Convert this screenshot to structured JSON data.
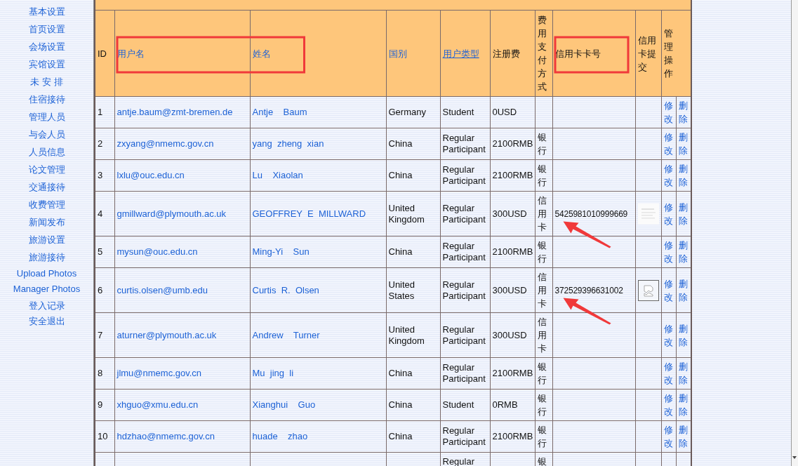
{
  "sidebar": {
    "items": [
      {
        "label": "基本设置"
      },
      {
        "label": "首页设置"
      },
      {
        "label": "会场设置"
      },
      {
        "label": "宾馆设置"
      },
      {
        "label": "未 安 排"
      },
      {
        "label": "住宿接待"
      },
      {
        "label": "管理人员"
      },
      {
        "label": "与会人员"
      },
      {
        "label": "人员信息"
      },
      {
        "label": "论文管理"
      },
      {
        "label": "交通接待"
      },
      {
        "label": "收费管理"
      },
      {
        "label": "新闻发布"
      },
      {
        "label": "旅游设置"
      },
      {
        "label": "旅游接待"
      },
      {
        "label": "Upload Photos"
      },
      {
        "label": "Manager Photos"
      },
      {
        "label": "登入记录"
      },
      {
        "label": "安全退出"
      }
    ]
  },
  "table": {
    "columns": [
      {
        "label": "ID",
        "kind": "plain",
        "link": false,
        "highlighted": false
      },
      {
        "label": "用户名",
        "kind": "plain",
        "link": true,
        "highlighted": true
      },
      {
        "label": "姓名",
        "kind": "plain",
        "link": true,
        "highlighted": true
      },
      {
        "label": "国别",
        "kind": "plain",
        "link": true,
        "highlighted": false
      },
      {
        "label": "用户类型",
        "kind": "plain",
        "link": true,
        "highlighted": false
      },
      {
        "label": "注册费",
        "kind": "plain",
        "link": false,
        "highlighted": false
      },
      {
        "label": "费用支付方式",
        "kind": "vertical",
        "link": false,
        "highlighted": false
      },
      {
        "label": "信用卡卡号",
        "kind": "plain",
        "link": false,
        "highlighted": true
      },
      {
        "label": "信用卡提交",
        "kind": "plain",
        "link": false,
        "highlighted": false
      },
      {
        "label": "管理操作",
        "kind": "pair",
        "link": false,
        "highlighted": false
      }
    ],
    "rows": [
      {
        "id": "1",
        "username": "antje.baum@zmt-bremen.de",
        "name": "Antje    Baum",
        "country": "Germany",
        "type": "Student",
        "fee": "0USD",
        "actions": [
          "修改",
          "删除"
        ],
        "arrow": false
      },
      {
        "id": "2",
        "username": "zxyang@nmemc.gov.cn",
        "name": "yang  zheng  xian",
        "country": "China",
        "type": "Regular Participant",
        "fee": "2100RMB",
        "payment": "银行",
        "actions": [
          "修改",
          "删除"
        ],
        "arrow": false
      },
      {
        "id": "3",
        "username": "lxlu@ouc.edu.cn",
        "name": "Lu    Xiaolan",
        "country": "China",
        "type": "Regular Participant",
        "fee": "2100RMB",
        "payment": "银行",
        "actions": [
          "修改",
          "删除"
        ],
        "arrow": false
      },
      {
        "id": "4",
        "username": "gmillward@plymouth.ac.uk",
        "name": "GEOFFREY  E  MILLWARD",
        "country": "United Kingdom",
        "type": "Regular Participant",
        "fee": "300USD",
        "payment": "信用卡",
        "card_number": "5425981010999669",
        "card_image": {
          "kind": "document"
        },
        "actions": [
          "修改",
          "删除"
        ],
        "arrow": true
      },
      {
        "id": "5",
        "username": "mysun@ouc.edu.cn",
        "name": "Ming-Yi    Sun",
        "country": "China",
        "type": "Regular Participant",
        "fee": "2100RMB",
        "payment": "银行",
        "actions": [
          "修改",
          "删除"
        ],
        "arrow": false
      },
      {
        "id": "6",
        "username": "curtis.olsen@umb.edu",
        "name": "Curtis  R.  Olsen",
        "country": "United States",
        "type": "Regular Participant",
        "fee": "300USD",
        "payment": "信用卡",
        "card_number": "372529396631002",
        "card_image": {
          "kind": "broken"
        },
        "actions": [
          "修改",
          "删除"
        ],
        "arrow": true
      },
      {
        "id": "7",
        "username": "aturner@plymouth.ac.uk",
        "name": "Andrew    Turner",
        "country": "United Kingdom",
        "type": "Regular Participant",
        "fee": "300USD",
        "payment": "信用卡",
        "actions": [
          "修改",
          "删除"
        ],
        "arrow": false
      },
      {
        "id": "8",
        "username": "jlmu@nmemc.gov.cn",
        "name": "Mu  jing  li",
        "country": "China",
        "type": "Regular Participant",
        "fee": "2100RMB",
        "payment": "银行",
        "actions": [
          "修改",
          "删除"
        ],
        "arrow": false
      },
      {
        "id": "9",
        "username": "xhguo@xmu.edu.cn",
        "name": "Xianghui    Guo",
        "country": "China",
        "type": "Student",
        "fee": "0RMB",
        "payment": "银行",
        "actions": [
          "修改",
          "删除"
        ],
        "arrow": false
      },
      {
        "id": "10",
        "username": "hdzhao@nmemc.gov.cn",
        "name": "huade    zhao",
        "country": "China",
        "type": "Regular Participant",
        "fee": "2100RMB",
        "payment": "银行",
        "actions": [
          "修改",
          "删除"
        ],
        "arrow": false
      },
      {
        "type": "Regular",
        "payment": "银",
        "arrow": false
      }
    ]
  }
}
